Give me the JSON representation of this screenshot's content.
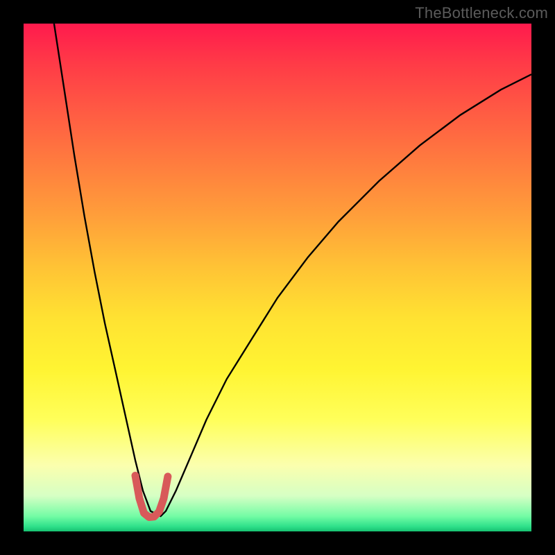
{
  "watermark": "TheBottleneck.com",
  "chart_data": {
    "type": "line",
    "title": "",
    "xlabel": "",
    "ylabel": "",
    "xlim": [
      0,
      100
    ],
    "ylim": [
      0,
      100
    ],
    "grid": false,
    "legend": false,
    "background": {
      "gradient": "vertical",
      "stops": [
        {
          "pos": 0.0,
          "color": "#ff1a4d"
        },
        {
          "pos": 0.5,
          "color": "#ffc335"
        },
        {
          "pos": 0.8,
          "color": "#ffff5a"
        },
        {
          "pos": 1.0,
          "color": "#16c271"
        }
      ]
    },
    "series": [
      {
        "name": "curve",
        "color": "#000000",
        "width": 2,
        "x": [
          6,
          8,
          10,
          12,
          14,
          16,
          18,
          20,
          22,
          23.5,
          25,
          27,
          28,
          30,
          33,
          36,
          40,
          45,
          50,
          56,
          62,
          70,
          78,
          86,
          94,
          100
        ],
        "y": [
          100,
          87,
          74,
          62,
          51,
          41,
          32,
          23,
          14,
          8,
          4,
          3,
          4,
          8,
          15,
          22,
          30,
          38,
          46,
          54,
          61,
          69,
          76,
          82,
          87,
          90
        ]
      },
      {
        "name": "min-marker",
        "color": "#d85a5a",
        "width": 9,
        "linecap": "round",
        "x": [
          22.0,
          22.8,
          23.7,
          24.7,
          25.7,
          26.7,
          27.6,
          28.4
        ],
        "y": [
          11.0,
          6.5,
          3.6,
          2.8,
          2.9,
          3.9,
          6.5,
          10.8
        ]
      }
    ],
    "annotations": [
      {
        "text": "TheBottleneck.com",
        "position": "top-right",
        "color": "#5b5b5b"
      }
    ]
  }
}
